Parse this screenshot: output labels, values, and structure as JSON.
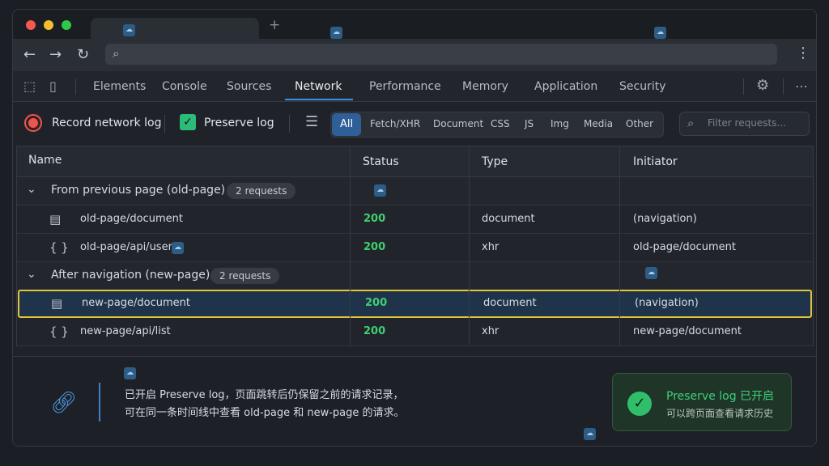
{
  "browser": {
    "new_tab_symbol": "+",
    "back_icon": "arrow-left",
    "forward_icon": "arrow-right",
    "reload_icon": "reload",
    "search_icon": "magnifier",
    "menu_icon": "kebab",
    "traffic_light_colors": [
      "#f25a50",
      "#f3be2e",
      "#2fc84a"
    ]
  },
  "devtools": {
    "tabs": [
      {
        "label": "Elements"
      },
      {
        "label": "Console"
      },
      {
        "label": "Sources"
      },
      {
        "label": "Network",
        "active": true
      },
      {
        "label": "Performance"
      },
      {
        "label": "Memory"
      },
      {
        "label": "Application"
      },
      {
        "label": "Security"
      }
    ],
    "accent_color": "#3d8ee6"
  },
  "toolbar": {
    "record_label": "Record network log",
    "preserve_label": "Preserve log",
    "preserve_checked": true,
    "filter_chips": [
      "All",
      "Fetch/XHR",
      "Document",
      "CSS",
      "JS",
      "Img",
      "Media",
      "Other"
    ],
    "active_chip": "All",
    "search_placeholder": "Filter requests..."
  },
  "table": {
    "columns": [
      "Name",
      "Status",
      "Type",
      "Initiator"
    ],
    "groups": [
      {
        "label": "From previous page (old-page)",
        "badge": "2 requests",
        "rows": [
          {
            "icon": "document-icon",
            "name": "old-page/document",
            "status": "200",
            "type": "document",
            "initiator": "(navigation)"
          },
          {
            "icon": "braces-icon",
            "name": "old-page/api/user",
            "status": "200",
            "type": "xhr",
            "initiator": "old-page/document"
          }
        ]
      },
      {
        "label": "After navigation (new-page)",
        "badge": "2 requests",
        "rows": [
          {
            "icon": "document-icon",
            "name": "new-page/document",
            "status": "200",
            "type": "document",
            "initiator": "(navigation)",
            "selected": true
          },
          {
            "icon": "braces-icon",
            "name": "new-page/api/list",
            "status": "200",
            "type": "xhr",
            "initiator": "new-page/document"
          }
        ]
      }
    ],
    "status_color": "#3fcf71",
    "selection_color": "#e3c53a"
  },
  "info": {
    "line1": "已开启 Preserve log，页面跳转后仍保留之前的请求记录，",
    "line2": "可在同一条时间线中查看 old-page 和 new-page 的请求。",
    "toast_title": "Preserve log 已开启",
    "toast_subtitle": "可以跨页面查看请求历史",
    "toast_color": "#2fbf6a"
  }
}
